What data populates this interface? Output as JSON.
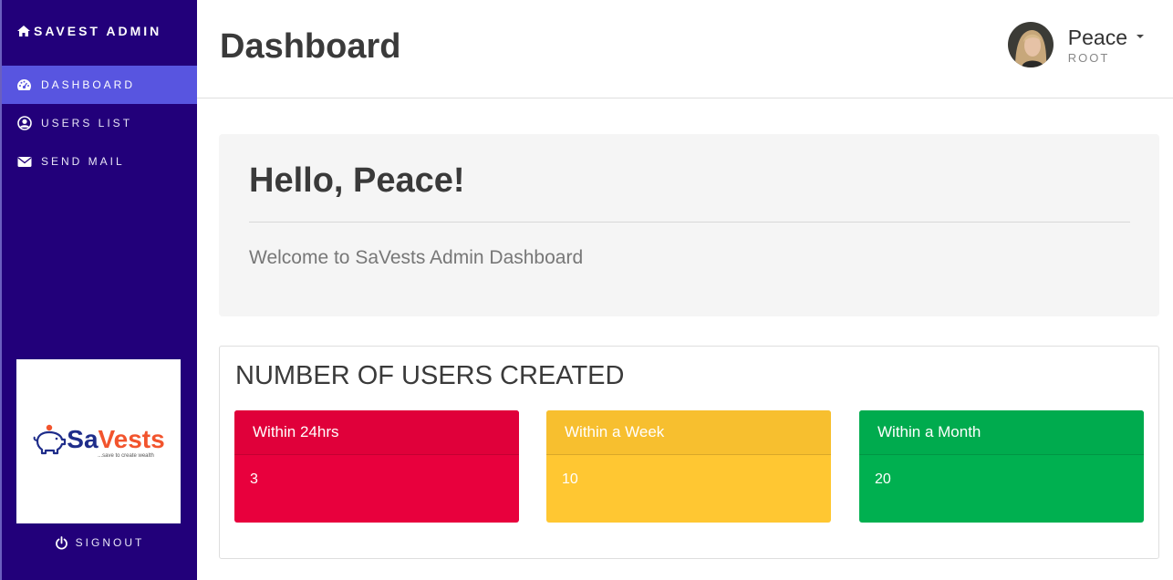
{
  "sidebar": {
    "brand": "SAVEST ADMIN",
    "items": [
      {
        "label": "DASHBOARD",
        "icon": "dashboard-icon",
        "active": true
      },
      {
        "label": "USERS LIST",
        "icon": "user-circle-icon",
        "active": false
      },
      {
        "label": "SEND MAIL",
        "icon": "envelope-icon",
        "active": false
      }
    ],
    "logo": {
      "sa": "Sa",
      "vests": "Vests",
      "tagline": "...save to create wealth"
    },
    "signout": "SIGNOUT"
  },
  "header": {
    "title": "Dashboard",
    "user": {
      "name": "Peace",
      "role": "ROOT"
    }
  },
  "welcome": {
    "greeting": "Hello, Peace!",
    "message": "Welcome to SaVests Admin Dashboard"
  },
  "stats": {
    "title": "NUMBER OF USERS CREATED",
    "cards": [
      {
        "label": "Within 24hrs",
        "value": "3",
        "color": "#e8003d"
      },
      {
        "label": "Within a Week",
        "value": "10",
        "color": "#ffc732"
      },
      {
        "label": "Within a Month",
        "value": "20",
        "color": "#00b050"
      }
    ]
  },
  "colors": {
    "sidebar": "#22007a",
    "active_item": "#5855e0"
  }
}
